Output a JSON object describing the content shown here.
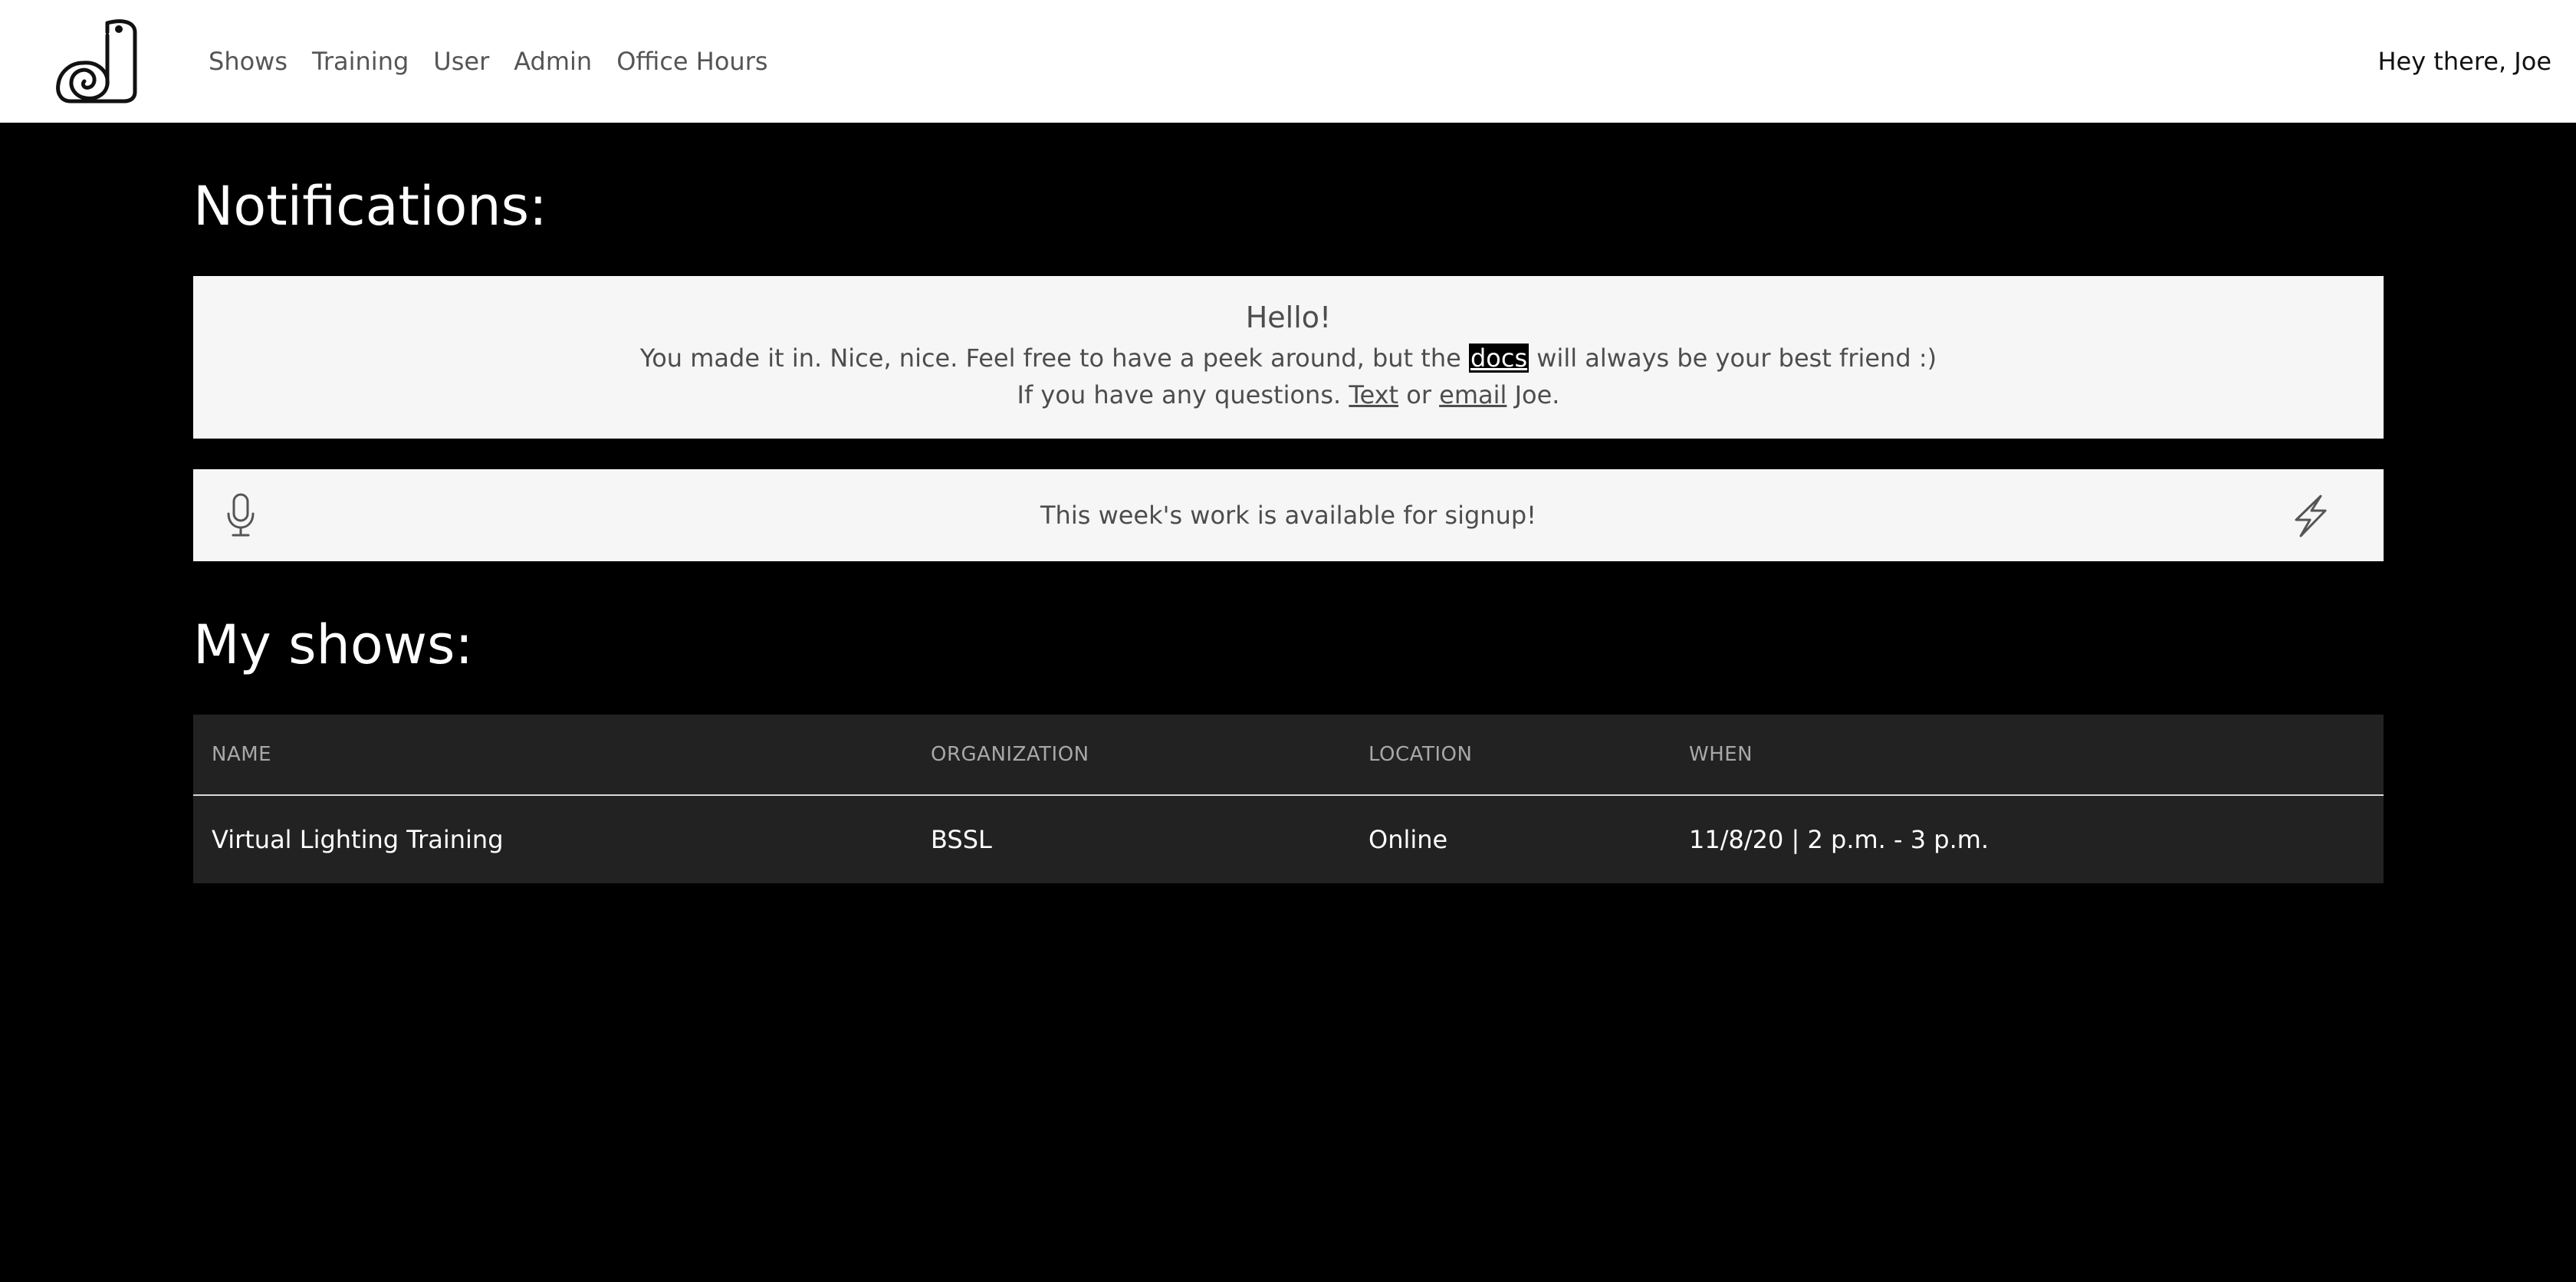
{
  "nav": {
    "logo_icon": "snail-logo-icon",
    "links": [
      "Shows",
      "Training",
      "User",
      "Admin",
      "Office Hours"
    ],
    "greeting": "Hey there, Joe"
  },
  "notifications": {
    "title": "Notifications:",
    "welcome": {
      "heading": "Hello!",
      "line1_before": "You made it in. Nice, nice. Feel free to have a peek around, but the ",
      "line1_link": "docs",
      "line1_after": " will always be your best friend :)",
      "line2_before": "If you have any questions. ",
      "line2_link1": "Text",
      "line2_middle": " or ",
      "line2_link2": "email",
      "line2_after": " Joe."
    },
    "announcement": {
      "text": "This week's work is available for signup!",
      "left_icon": "microphone-icon",
      "right_icon": "lightning-icon"
    }
  },
  "shows": {
    "title": "My shows:",
    "columns": [
      "NAME",
      "ORGANIZATION",
      "LOCATION",
      "WHEN"
    ],
    "rows": [
      {
        "name": "Virtual Lighting Training",
        "organization": "BSSL",
        "location": "Online",
        "when": "11/8/20 | 2 p.m. - 3 p.m."
      }
    ]
  },
  "colors": {
    "page_background": "#000000",
    "navbar_background": "#ffffff",
    "panel_background": "#f6f6f6",
    "table_background": "#222222",
    "highlight_background": "#000000"
  }
}
